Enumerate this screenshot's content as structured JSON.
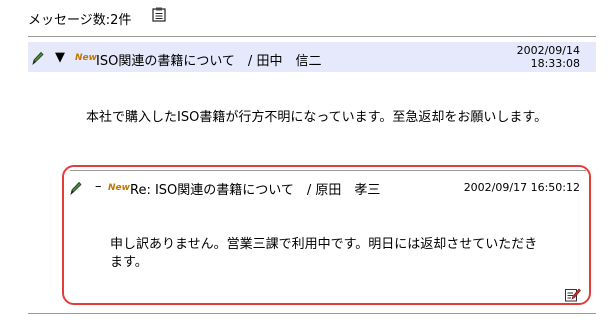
{
  "header": {
    "message_count": "メッセージ数:2件"
  },
  "new_label": "New",
  "thread": {
    "title": "ISO関連の書籍について　/ 田中　信二",
    "date": "2002/09/14",
    "time": "18:33:08",
    "body": "本社で購入したISO書籍が行方不明になっています。至急返却をお願いします。"
  },
  "reply": {
    "marker": "–",
    "title": "Re: ISO関連の書籍について　/ 原田　孝三",
    "datetime": "2002/09/17 16:50:12",
    "body": "申し訳ありません。営業三課で利用中です。明日には返却させていただきます。"
  },
  "colors": {
    "bar_bg": "#e6e9fb",
    "highlight_border": "#e23c3c",
    "new_badge": "#c07800"
  },
  "icons": [
    "clipboard-icon",
    "pencil-icon",
    "expand-triangle-icon",
    "edit-icon"
  ]
}
